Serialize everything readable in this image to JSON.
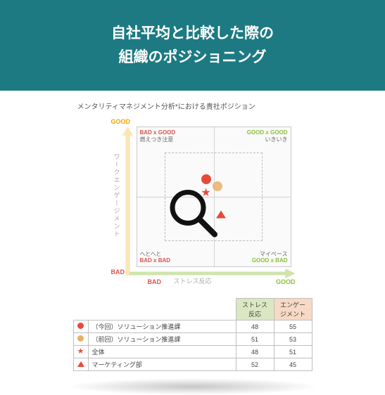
{
  "hero": {
    "line1": "自社平均と比較した際の",
    "line2": "組織のポジショニング"
  },
  "report": {
    "title": "メンタリティマネジメント分析*における貴社ポジション"
  },
  "quad": {
    "y_good": "GOOD",
    "y_bad": "BAD",
    "x_bad": "BAD",
    "x_good": "GOOD",
    "y_axis": "ワークエンゲージメント",
    "x_axis": "ストレス反応",
    "corners": {
      "tl_tag": "BAD x GOOD",
      "tl_sub": "燃えつき注意",
      "tr_tag": "GOOD x GOOD",
      "tr_sub": "いきいき",
      "bl_tag": "BAD x BAD",
      "bl_sub": "へとへと",
      "br_tag": "GOOD x BAD",
      "br_sub": "マイペース"
    }
  },
  "table": {
    "headers": {
      "stress": "ストレス反応",
      "engage": "エンゲージメント"
    },
    "rows": [
      {
        "marker": "circle-red",
        "label": "（今回）ソリューション推進課",
        "stress": "48",
        "engage": "55"
      },
      {
        "marker": "circle-gold",
        "label": "（前回）ソリューション推進課",
        "stress": "51",
        "engage": "53"
      },
      {
        "marker": "star",
        "label": "全体",
        "stress": "48",
        "engage": "51"
      },
      {
        "marker": "tri",
        "label": "マーケティング部",
        "stress": "52",
        "engage": "45"
      }
    ]
  },
  "chart_data": {
    "type": "scatter",
    "title": "メンタリティマネジメント分析*における貴社ポジション",
    "xlabel": "ストレス反応",
    "ylabel": "ワークエンゲージメント",
    "x_good_direction": "right",
    "y_good_direction": "up",
    "quadrants": {
      "top_left": {
        "tag": "BAD x GOOD",
        "label": "燃えつき注意"
      },
      "top_right": {
        "tag": "GOOD x GOOD",
        "label": "いきいき"
      },
      "bottom_left": {
        "tag": "BAD x BAD",
        "label": "へとへと"
      },
      "bottom_right": {
        "tag": "GOOD x BAD",
        "label": "マイペース"
      }
    },
    "series": [
      {
        "name": "（今回）ソリューション推進課",
        "marker": "circle-red",
        "x": 48,
        "y": 55
      },
      {
        "name": "（前回）ソリューション推進課",
        "marker": "circle-gold",
        "x": 51,
        "y": 53
      },
      {
        "name": "全体",
        "marker": "star",
        "x": 48,
        "y": 51
      },
      {
        "name": "マーケティング部",
        "marker": "triangle",
        "x": 52,
        "y": 45
      }
    ],
    "xlim": [
      30,
      70
    ],
    "ylim": [
      30,
      70
    ]
  }
}
